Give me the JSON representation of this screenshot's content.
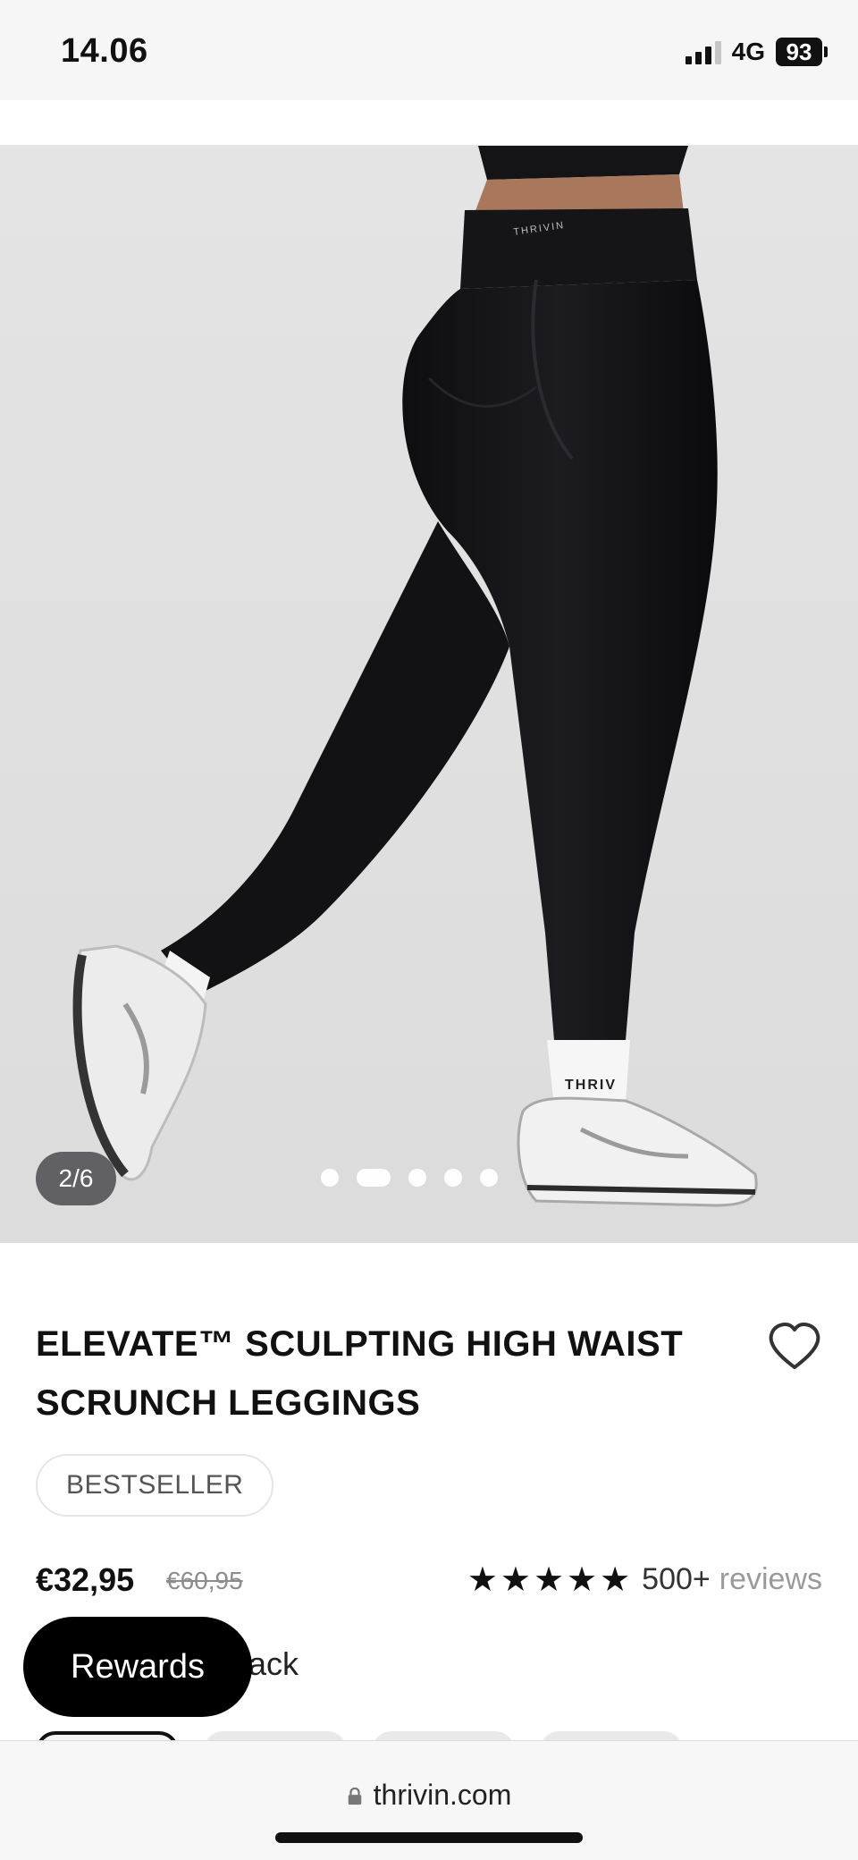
{
  "status_bar": {
    "time": "14.06",
    "network": "4G",
    "battery": "93"
  },
  "gallery": {
    "counter": "2/6",
    "dots_total": 5,
    "active_dot_index": 1,
    "image_brand_text": "THRIVIN"
  },
  "product": {
    "title": "ELEVATE™ SCULPTING HIGH WAIST SCRUNCH LEGGINGS",
    "badge": "BESTSELLER",
    "price": "€32,95",
    "original_price": "€60,95",
    "rating_stars": "★★★★★",
    "review_count": "500+",
    "review_word": "reviews",
    "color_label_partial": "lack"
  },
  "rewards": {
    "label": "Rewards"
  },
  "browser": {
    "url": "thrivin.com"
  },
  "colors": {
    "accent": "#000000",
    "image_bg": "#e3e3e3"
  }
}
